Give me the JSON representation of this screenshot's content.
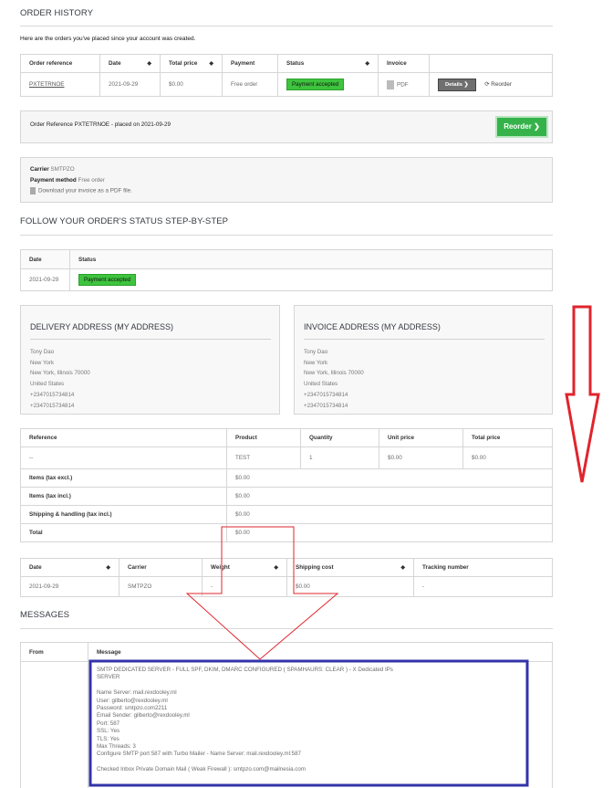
{
  "order_history": {
    "title": "ORDER HISTORY",
    "intro": "Here are the orders you've placed since your account was created.",
    "headers": [
      "Order reference",
      "Date",
      "Total price",
      "Payment",
      "Status",
      "Invoice"
    ],
    "row": {
      "reference": "PXTETRNOE",
      "date": "2021-09-29",
      "total": "$0.00",
      "payment": "Free order",
      "status": "Payment accepted",
      "invoice": "PDF",
      "details_label": "Details",
      "reorder_label": "Reorder"
    }
  },
  "order_summary": {
    "text": "Order Reference PXTETRNOE - placed on 2021-09-29",
    "reorder_button": "Reorder"
  },
  "order_info": {
    "carrier_label": "Carrier",
    "carrier_value": "SMTPZO",
    "payment_label": "Payment method",
    "payment_value": "Free order",
    "download_text": "Download your invoice as a PDF file."
  },
  "status_steps": {
    "title": "FOLLOW YOUR ORDER'S STATUS STEP-BY-STEP",
    "headers": [
      "Date",
      "Status"
    ],
    "date": "2021-09-29",
    "status": "Payment accepted"
  },
  "delivery_address": {
    "title": "DELIVERY ADDRESS (MY ADDRESS)",
    "lines": [
      "Tony Dao",
      "New York",
      "New York, Illinois 70000",
      "United States",
      "+2347015734814",
      "+2347015734814"
    ]
  },
  "invoice_address": {
    "title": "INVOICE ADDRESS (MY ADDRESS)",
    "lines": [
      "Tony Dao",
      "New York",
      "New York, Illinois 70000",
      "United States",
      "+2347015734814",
      "+2347015734814"
    ]
  },
  "products": {
    "headers": [
      "Reference",
      "Product",
      "Quantity",
      "Unit price",
      "Total price"
    ],
    "row": {
      "reference": "--",
      "product": "TEST",
      "quantity": "1",
      "unit": "$0.00",
      "total": "$0.00"
    },
    "totals": [
      {
        "label": "Items (tax excl.)",
        "value": "$0.00"
      },
      {
        "label": "Items (tax incl.)",
        "value": "$0.00"
      },
      {
        "label": "Shipping & handling (tax incl.)",
        "value": "$0.00"
      },
      {
        "label": "Total",
        "value": "$0.00"
      }
    ]
  },
  "shipping": {
    "headers": [
      "Date",
      "Carrier",
      "Weight",
      "Shipping cost",
      "Tracking number"
    ],
    "row": {
      "date": "2021-09-29",
      "carrier": "SMTPZO",
      "weight": "-",
      "cost": "$0.00",
      "tracking": "-"
    }
  },
  "messages": {
    "title": "MESSAGES",
    "headers": [
      "From",
      "Message"
    ],
    "body": "SMTP DEDICATED SERVER - FULL SPF, DKIM, DMARC CONFIGURED ( SPAMHAURS: CLEAR ) - X Dedicated IPs\nSERVER\n\nName Server: mail.rexdooley.ml\nUser: gilberto@rexdooley.ml\nPassword: smtpzo.com2211\nEmail Sender: gilberto@rexdooley.ml\nPort: 587\nSSL: Yes\nTLS: Yes\nMax Threads: 3\nConfigure SMTP port 587 with Turbo Mailer - Name Server: mail.rexdooley.ml:587\n\nChecked Inbox Private Domain Mail ( Weak Firewall ): smtpzo.com@mailnesia.com"
  },
  "colors": {
    "annotation_red": "#e0242c",
    "highlight_blue": "#3333aa",
    "status_green": "#3ec43e",
    "reorder_green": "#35b34a"
  }
}
